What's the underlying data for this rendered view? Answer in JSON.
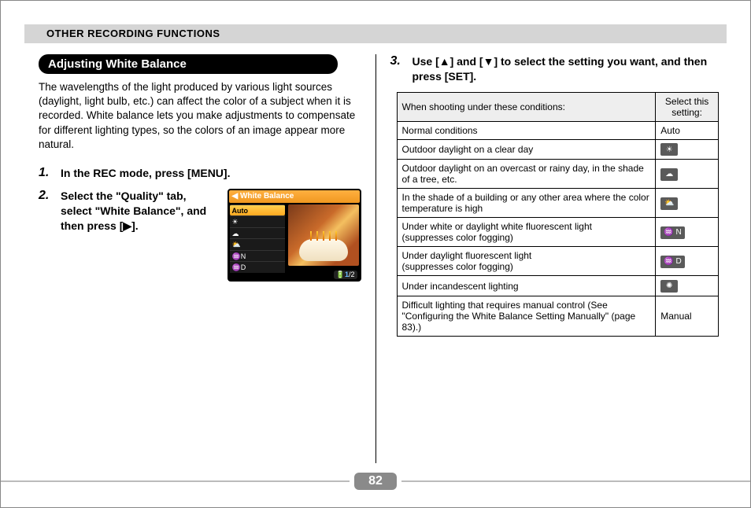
{
  "header": {
    "title": "OTHER RECORDING FUNCTIONS"
  },
  "section": {
    "title": "Adjusting White Balance"
  },
  "intro": "The wavelengths of the light produced by various light sources (daylight, light bulb, etc.) can affect the color of a subject when it is recorded. White balance lets you make adjustments to compensate for different lighting types, so the colors of an image appear more natural.",
  "steps": {
    "s1": {
      "num": "1.",
      "text": "In the REC mode, press [MENU]."
    },
    "s2": {
      "num": "2.",
      "text": "Select the \"Quality\" tab, select \"White Balance\", and then press [▶]."
    },
    "s3": {
      "num": "3.",
      "text": "Use [▲] and [▼] to select the setting you want, and then press [SET]."
    }
  },
  "lcd": {
    "title": "◀ White Balance",
    "items": [
      "Auto",
      "☀",
      "☁",
      "⛅",
      "N",
      "D"
    ],
    "page_indicator_prefix": "1",
    "page_indicator_suffix": "/2"
  },
  "table": {
    "head_left": "When shooting under these conditions:",
    "head_right": "Select this setting:",
    "rows": [
      {
        "cond": "Normal conditions",
        "icon_type": "text",
        "icon_label": "Auto"
      },
      {
        "cond": "Outdoor daylight on a clear day",
        "icon_type": "glyph",
        "icon_label": "☀"
      },
      {
        "cond": "Outdoor daylight on an overcast or rainy day, in the shade of a tree, etc.",
        "icon_type": "glyph",
        "icon_label": "☁"
      },
      {
        "cond": "In the shade of a building or any other area where the color temperature is high",
        "icon_type": "glyph",
        "icon_label": "⛅"
      },
      {
        "cond": "Under white or daylight white fluorescent light\n(suppresses color fogging)",
        "icon_type": "glyph",
        "icon_label": "♒ N"
      },
      {
        "cond": "Under daylight fluorescent light\n(suppresses color fogging)",
        "icon_type": "glyph",
        "icon_label": "♒ D"
      },
      {
        "cond": "Under incandescent lighting",
        "icon_type": "glyph",
        "icon_label": "✺"
      },
      {
        "cond": "Difficult lighting that requires manual control (See \"Configuring the White Balance Setting Manually\" (page 83).)",
        "icon_type": "text",
        "icon_label": "Manual"
      }
    ]
  },
  "page_number": "82"
}
